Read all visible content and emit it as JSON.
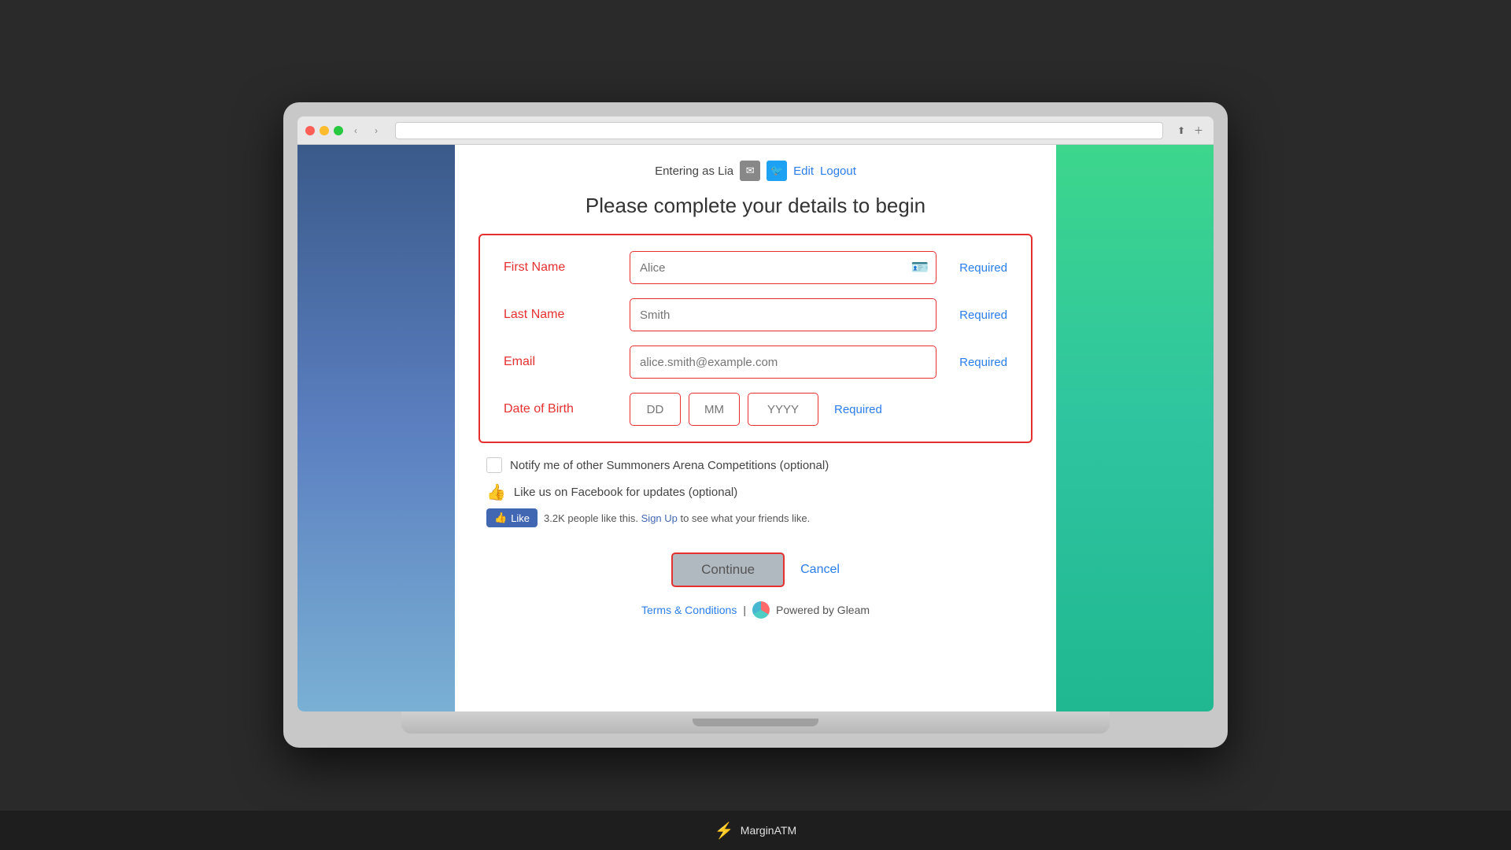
{
  "browser": {
    "dots": [
      "red",
      "yellow",
      "green"
    ]
  },
  "header": {
    "entering_text": "Entering as Lia",
    "edit_label": "Edit",
    "logout_label": "Logout"
  },
  "page": {
    "title": "Please complete your details to begin"
  },
  "form": {
    "first_name_label": "First Name",
    "first_name_placeholder": "Alice",
    "last_name_label": "Last Name",
    "last_name_placeholder": "Smith",
    "email_label": "Email",
    "email_placeholder": "alice.smith@example.com",
    "dob_label": "Date of Birth",
    "dob_dd_placeholder": "DD",
    "dob_mm_placeholder": "MM",
    "dob_yyyy_placeholder": "YYYY",
    "required_label": "Required"
  },
  "extras": {
    "notify_label": "Notify me of other Summoners Arena Competitions (optional)",
    "facebook_label": "Like us on Facebook for updates (optional)",
    "fb_like_button": "Like",
    "fb_count": "3.2K people like this.",
    "fb_signup_text": "Sign Up",
    "fb_signup_suffix": "to see what your friends like."
  },
  "buttons": {
    "continue_label": "Continue",
    "cancel_label": "Cancel"
  },
  "footer": {
    "terms_label": "Terms & Conditions",
    "separator": "|",
    "powered_label": "Powered by Gleam"
  },
  "taskbar": {
    "app_name": "MarginATM"
  }
}
